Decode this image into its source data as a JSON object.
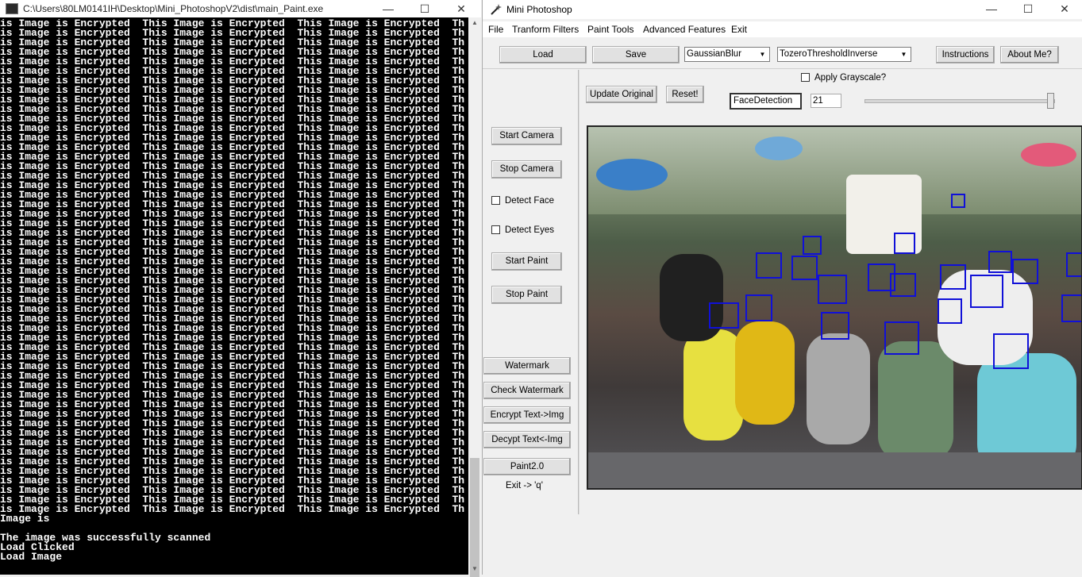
{
  "console": {
    "title": "C:\\Users\\80LM0141IH\\Desktop\\Mini_PhotoshopV2\\dist\\main_Paint.exe",
    "line_unit": "This Image is Encrypted  ",
    "encrypted_rows": 52,
    "tail": [
      "Image is",
      "",
      "The image was successfully scanned",
      "Load Clicked",
      "Load Image"
    ]
  },
  "app": {
    "title": "Mini Photoshop",
    "menu": [
      "File",
      "Tranform Filters",
      "Paint Tools",
      "Advanced Features",
      "Exit"
    ],
    "toolbar": {
      "load": "Load",
      "save": "Save",
      "filter_select": "GaussianBlur",
      "threshold_select": "TozeroThresholdInverse",
      "instructions": "Instructions",
      "about": "About Me?"
    },
    "grayscale_label": "Apply Grayscale?",
    "update_original": "Update Original",
    "reset": "Reset!",
    "mode_field": "FaceDetection",
    "value_field": "21",
    "slider_value": "21",
    "sidebar": {
      "start_camera": "Start Camera",
      "stop_camera": "Stop Camera",
      "detect_face": "Detect Face",
      "detect_eyes": "Detect Eyes",
      "start_paint": "Start Paint",
      "stop_paint": "Stop Paint",
      "watermark": "Watermark",
      "check_watermark": "Check Watermark",
      "encrypt": "Encrypt Text->Img",
      "decrypt": "Decypt Text<-Img",
      "paint2": "Paint2.0",
      "exit_hint": "Exit -> 'q'"
    },
    "face_box_color": "#1010d8"
  }
}
